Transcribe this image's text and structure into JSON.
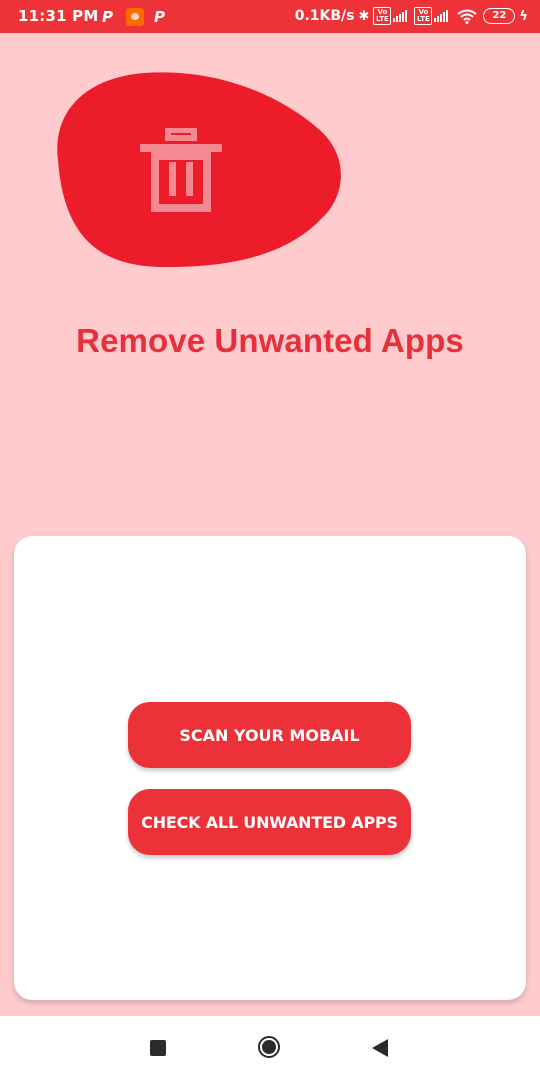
{
  "status_bar": {
    "time": "11:31 PM",
    "left_icons": [
      "p-icon",
      "notification-icon",
      "p-icon"
    ],
    "net_speed": "0.1KB/s",
    "volte_label": "Vo LTE",
    "battery_level": "22",
    "icons": [
      "bluetooth-icon",
      "signal-icon",
      "wifi-icon",
      "battery-icon",
      "charging-icon"
    ]
  },
  "hero": {
    "icon": "trash-icon",
    "title": "Remove Unwanted Apps"
  },
  "actions": {
    "scan_label": "SCAN YOUR MOBAIL",
    "check_label": "CHECK ALL UNWANTED APPS"
  },
  "nav": {
    "icons": [
      "recents-icon",
      "home-icon",
      "back-icon"
    ]
  },
  "colors": {
    "accent": "#ec3139",
    "background": "#ffcbcc",
    "blob": "#ed1c2b",
    "card": "#ffffff"
  }
}
